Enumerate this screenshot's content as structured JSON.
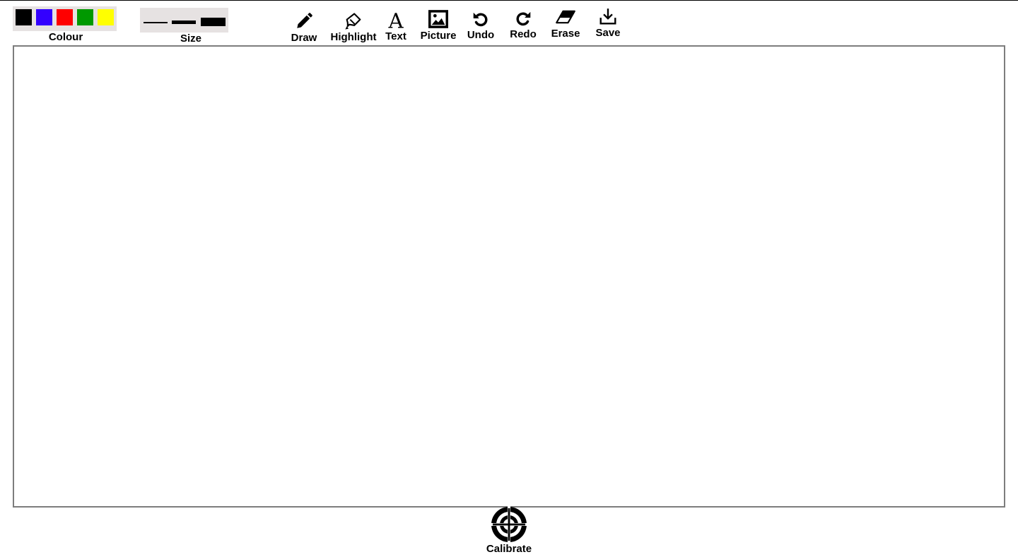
{
  "colour": {
    "label": "Colour",
    "swatches": [
      {
        "name": "black",
        "hex": "#000000"
      },
      {
        "name": "blue",
        "hex": "#3300ff"
      },
      {
        "name": "red",
        "hex": "#ff0000"
      },
      {
        "name": "green",
        "hex": "#009900"
      },
      {
        "name": "yellow",
        "hex": "#ffff00"
      }
    ]
  },
  "size": {
    "label": "Size",
    "options": [
      "thin",
      "medium",
      "thick"
    ]
  },
  "tools": [
    {
      "id": "draw",
      "label": "Draw",
      "icon": "pencil-icon"
    },
    {
      "id": "highlight",
      "label": "Highlight",
      "icon": "highlighter-icon"
    },
    {
      "id": "text",
      "label": "Text",
      "icon": "text-icon"
    },
    {
      "id": "picture",
      "label": "Picture",
      "icon": "image-icon"
    },
    {
      "id": "undo",
      "label": "Undo",
      "icon": "undo-icon"
    },
    {
      "id": "redo",
      "label": "Redo",
      "icon": "redo-icon"
    },
    {
      "id": "erase",
      "label": "Erase",
      "icon": "eraser-icon"
    },
    {
      "id": "save",
      "label": "Save",
      "icon": "download-icon"
    }
  ],
  "calibrate": {
    "label": "Calibrate",
    "icon": "crosshair-target-icon"
  },
  "colors": {
    "canvas_border": "#7d7d7d",
    "panel_bg": "#e6e2e2"
  }
}
